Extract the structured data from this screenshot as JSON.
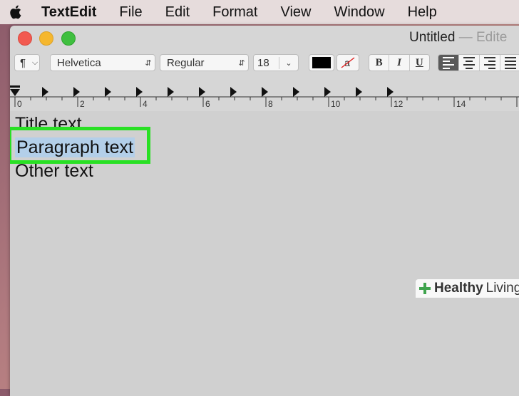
{
  "menubar": {
    "app_name": "TextEdit",
    "items": [
      "File",
      "Edit",
      "Format",
      "View",
      "Window",
      "Help"
    ]
  },
  "window": {
    "title": "Untitled",
    "title_suffix": "— Edite"
  },
  "toolbar": {
    "paragraph_symbol": "¶",
    "font_family": "Helvetica",
    "font_style": "Regular",
    "font_size": "18",
    "text_color": "#000000",
    "bold": "B",
    "italic": "I",
    "underline": "U"
  },
  "ruler": {
    "labels": [
      "0",
      "2",
      "4",
      "6",
      "8",
      "10",
      "12",
      "14"
    ]
  },
  "document": {
    "lines": [
      "Title text",
      "Paragraph text",
      "Other text"
    ]
  },
  "watermark": {
    "brand_a": "Healthy",
    "brand_b": "Living"
  },
  "colors": {
    "highlight": "#29e024",
    "selection": "#b3cfe9"
  }
}
